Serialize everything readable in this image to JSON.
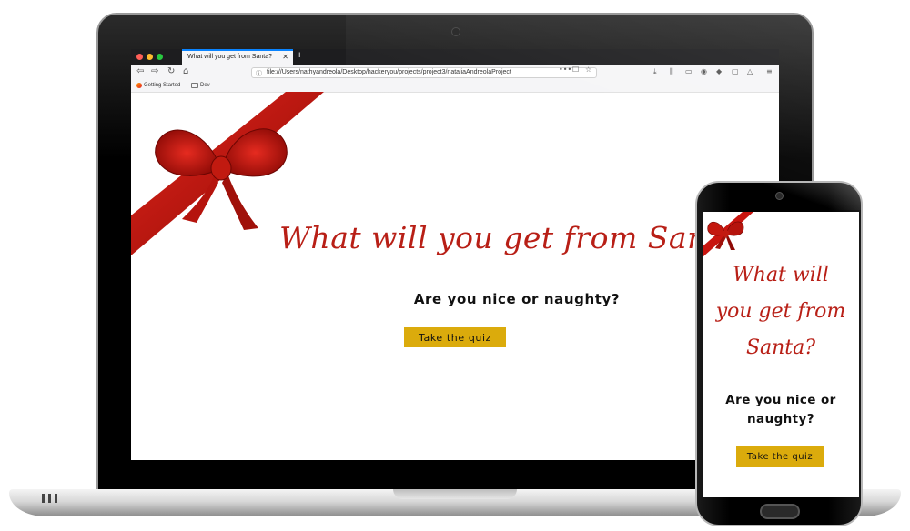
{
  "browser": {
    "tab_title": "What will you get from Santa?",
    "tab_close": "✕",
    "new_tab": "+",
    "url": "file:///Users/nathyandreola/Desktop/hackeryou/projects/project3/nataliaAndreolaProject",
    "url_actions": [
      "•••",
      "☐",
      "☆"
    ],
    "bookmarks": [
      {
        "label": "Getting Started",
        "icon": "firefox-icon"
      },
      {
        "label": "Dev",
        "icon": "folder-icon"
      }
    ],
    "traffic_light_colors": [
      "#ff5f57",
      "#febc2e",
      "#28c840"
    ],
    "accent": "#0a84ff"
  },
  "page": {
    "title": "What will you get from Santa?",
    "subtitle": "Are you nice or naughty?",
    "button_label": "Take the quiz"
  },
  "mobile": {
    "title_lines": [
      "What will",
      "you get from",
      "Santa?"
    ],
    "subtitle_lines": [
      "Are you nice or",
      "naughty?"
    ],
    "button_label": "Take the quiz"
  },
  "colors": {
    "title_red": "#b81f16",
    "button_gold": "#dbab0c",
    "ribbon_red": "#c8150f"
  }
}
